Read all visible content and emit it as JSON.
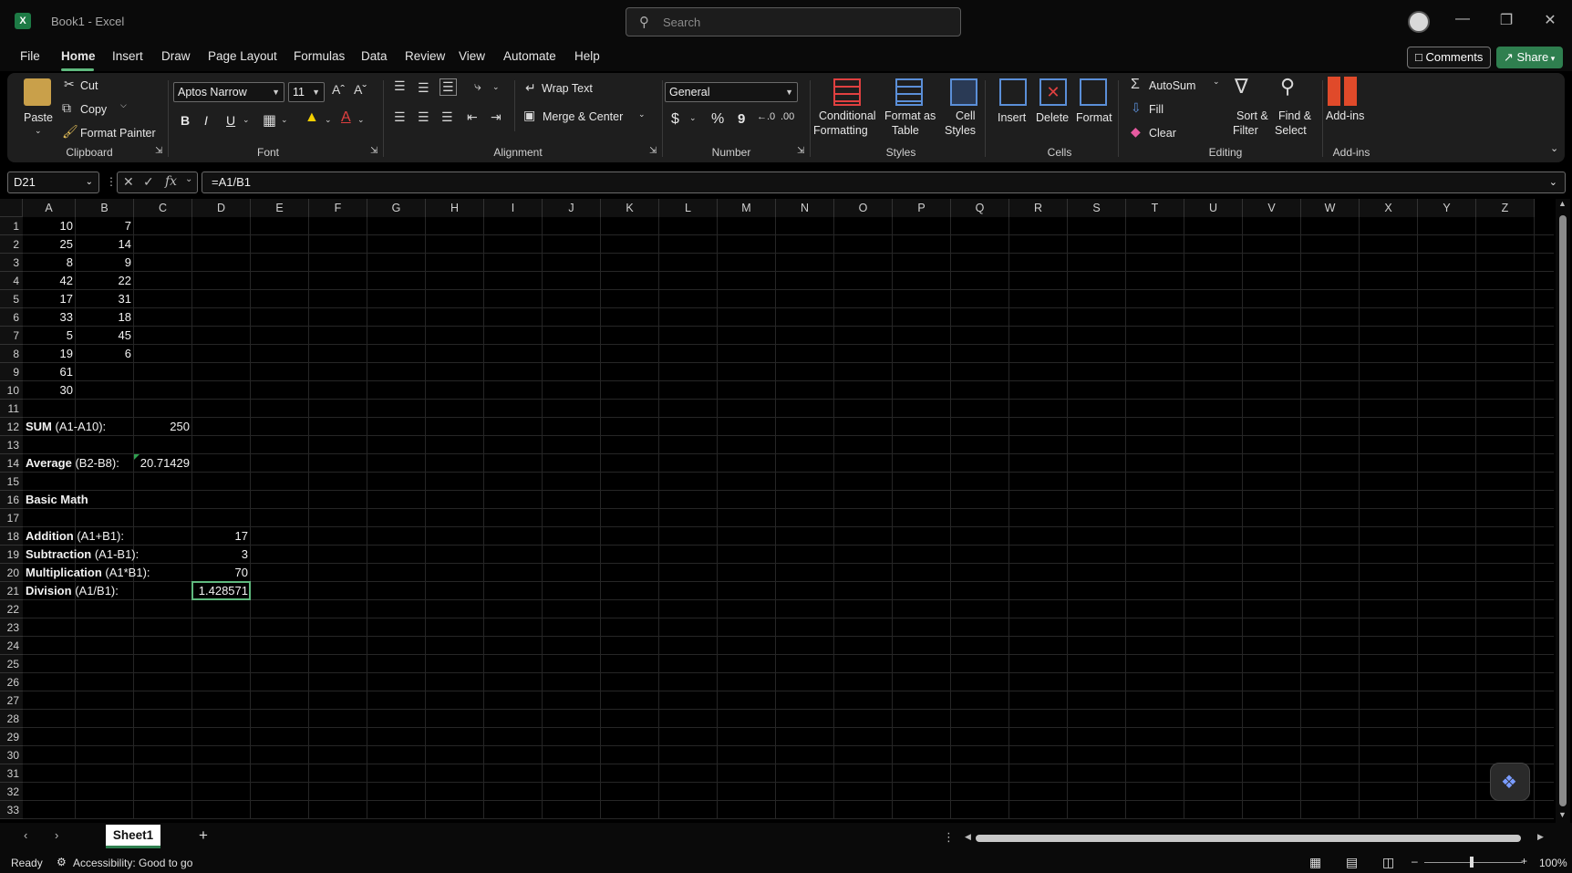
{
  "window": {
    "title": "Book1  -  Excel",
    "app_icon": "X"
  },
  "search": {
    "placeholder": "Search"
  },
  "menu_tabs": [
    "File",
    "Home",
    "Insert",
    "Draw",
    "Page Layout",
    "Formulas",
    "Data",
    "Review",
    "View",
    "Automate",
    "Help"
  ],
  "header_buttons": {
    "comments": "Comments",
    "share": "Share"
  },
  "ribbon": {
    "clipboard": {
      "paste": "Paste",
      "cut": "Cut",
      "copy": "Copy",
      "format_painter": "Format Painter",
      "label": "Clipboard"
    },
    "font": {
      "name": "Aptos Narrow",
      "size": "11",
      "bold": "B",
      "italic": "I",
      "underline": "U",
      "label": "Font"
    },
    "alignment": {
      "wrap_text": "Wrap Text",
      "merge_center": "Merge & Center",
      "label": "Alignment"
    },
    "number": {
      "format": "General",
      "currency": "$",
      "percent": "%",
      "comma": "9",
      "label": "Number"
    },
    "styles": {
      "conditional_1": "Conditional",
      "conditional_2": "Formatting",
      "format_table_1": "Format as",
      "format_table_2": "Table",
      "cell_styles_1": "Cell",
      "cell_styles_2": "Styles",
      "label": "Styles"
    },
    "cells": {
      "insert": "Insert",
      "delete": "Delete",
      "format": "Format",
      "label": "Cells"
    },
    "editing": {
      "autosum": "AutoSum",
      "fill": "Fill",
      "clear": "Clear",
      "sort_1": "Sort &",
      "sort_2": "Filter",
      "find_1": "Find &",
      "find_2": "Select",
      "label": "Editing"
    },
    "addins": {
      "addins": "Add-ins",
      "label": "Add-ins"
    }
  },
  "formula_bar": {
    "name_box": "D21",
    "fx": "fx",
    "formula": "=A1/B1"
  },
  "columns": [
    "A",
    "B",
    "C",
    "D",
    "E",
    "F",
    "G",
    "H",
    "I",
    "J",
    "K",
    "L",
    "M",
    "N",
    "O",
    "P",
    "Q",
    "R",
    "S",
    "T",
    "U",
    "V",
    "W",
    "X",
    "Y",
    "Z"
  ],
  "cells": {
    "A1": "10",
    "B1": "7",
    "A2": "25",
    "B2": "14",
    "A3": "8",
    "B3": "9",
    "A4": "42",
    "B4": "22",
    "A5": "17",
    "B5": "31",
    "A6": "33",
    "B6": "18",
    "A7": "5",
    "B7": "45",
    "A8": "19",
    "B8": "6",
    "A9": "61",
    "A10": "30",
    "A12_bold": "SUM",
    "A12_rest": " (A1-A10):",
    "C12": "250",
    "A14_bold": "Average",
    "A14_rest": " (B2-B8):",
    "C14": "20.71429",
    "A16_bold": "Basic Math",
    "A18_bold": "Addition",
    "A18_rest": " (A1+B1):",
    "D18": "17",
    "A19_bold": "Subtraction",
    "A19_rest": " (A1-B1):",
    "D19": "3",
    "A20_bold": "Multiplication",
    "A20_rest": " (A1*B1):",
    "D20": "70",
    "A21_bold": "Division",
    "A21_rest": " (A1/B1):",
    "D21": "1.428571"
  },
  "sheets": {
    "active": "Sheet1",
    "add": "+"
  },
  "status": {
    "ready": "Ready",
    "accessibility": "Accessibility: Good to go",
    "zoom": "100%"
  },
  "colors": {
    "accent_green": "#5fb97e",
    "share_green": "#2f7f4f"
  }
}
